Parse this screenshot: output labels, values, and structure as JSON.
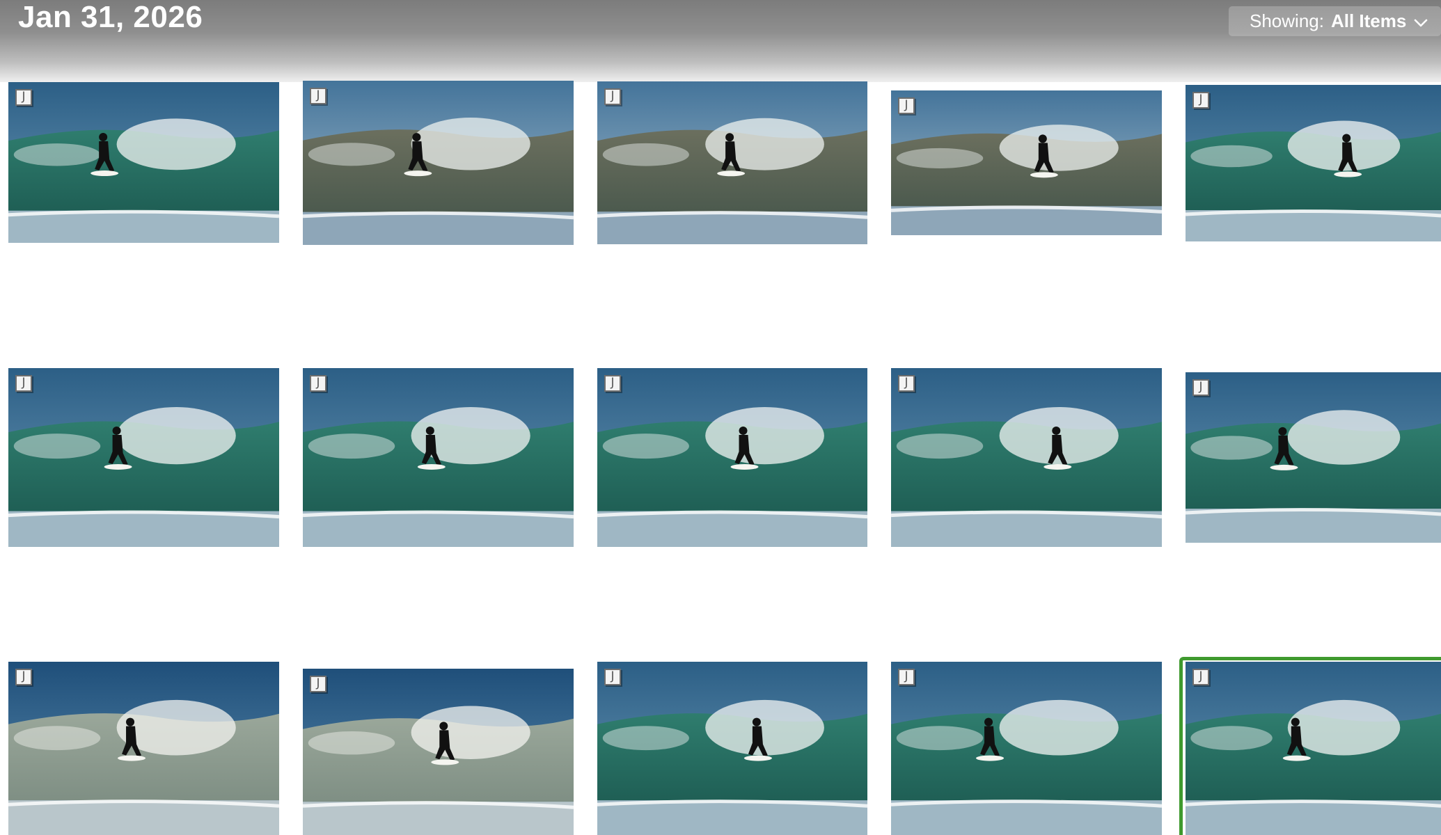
{
  "header": {
    "date_title": "Jan 31, 2026",
    "showing_label": "Showing:",
    "showing_value": "All Items",
    "dropdown_icon": "chevron-down-icon"
  },
  "colors": {
    "selection_border": "#3f9a2e",
    "header_gradient_top": "#7c7c7c",
    "header_gradient_bottom": "#efefef"
  },
  "photos": [
    {
      "row": 1,
      "col": 1,
      "badge": "J",
      "style": "teal",
      "selected": false
    },
    {
      "row": 1,
      "col": 2,
      "badge": "J",
      "style": "brown",
      "selected": false
    },
    {
      "row": 1,
      "col": 3,
      "badge": "J",
      "style": "brown",
      "selected": false
    },
    {
      "row": 1,
      "col": 4,
      "badge": "J",
      "style": "brown",
      "selected": false
    },
    {
      "row": 1,
      "col": 5,
      "badge": "J",
      "style": "teal",
      "selected": false
    },
    {
      "row": 2,
      "col": 1,
      "badge": "J",
      "style": "teal",
      "selected": false
    },
    {
      "row": 2,
      "col": 2,
      "badge": "J",
      "style": "teal",
      "selected": false
    },
    {
      "row": 2,
      "col": 3,
      "badge": "J",
      "style": "teal",
      "selected": false
    },
    {
      "row": 2,
      "col": 4,
      "badge": "J",
      "style": "teal",
      "selected": false
    },
    {
      "row": 2,
      "col": 5,
      "badge": "J",
      "style": "teal",
      "selected": false
    },
    {
      "row": 3,
      "col": 1,
      "badge": "J",
      "style": "foam",
      "selected": false
    },
    {
      "row": 3,
      "col": 2,
      "badge": "J",
      "style": "foam",
      "selected": false
    },
    {
      "row": 3,
      "col": 3,
      "badge": "J",
      "style": "teal",
      "selected": false
    },
    {
      "row": 3,
      "col": 4,
      "badge": "J",
      "style": "teal",
      "selected": false
    },
    {
      "row": 3,
      "col": 5,
      "badge": "J",
      "style": "teal",
      "selected": true
    }
  ]
}
